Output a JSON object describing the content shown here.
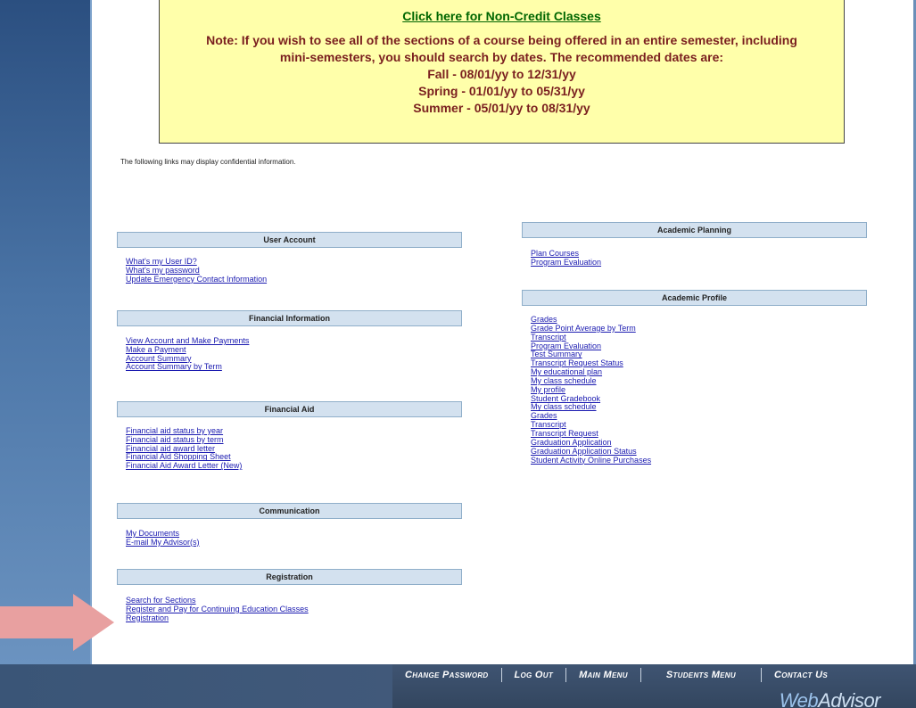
{
  "notice": {
    "link": "Click here for Non-Credit Classes",
    "lines": [
      "Note: If you wish to see all of the sections of a course being offered in an entire semester, including",
      "mini-semesters, you should search by dates. The recommended dates are:",
      "Fall - 08/01/yy to 12/31/yy",
      "Spring - 01/01/yy to 05/31/yy",
      "Summer - 05/01/yy to 08/31/yy"
    ]
  },
  "confidential_text": "The following links may display confidential information.",
  "sections": {
    "user_account": {
      "title": "User Account",
      "links": [
        "What's my User ID?",
        "What's my password",
        "Update Emergency Contact Information"
      ]
    },
    "financial_information": {
      "title": "Financial Information",
      "links": [
        "View Account and Make Payments",
        "Make a Payment",
        "Account Summary",
        "Account Summary by Term"
      ]
    },
    "financial_aid": {
      "title": "Financial Aid",
      "links": [
        "Financial aid status by year",
        "Financial aid status by term",
        "Financial aid award letter",
        "Financial Aid Shopping Sheet",
        "Financial Aid Award Letter (New)"
      ]
    },
    "communication": {
      "title": "Communication",
      "links": [
        "My Documents",
        "E-mail My Advisor(s)"
      ]
    },
    "registration": {
      "title": "Registration",
      "links": [
        "Search for Sections",
        "Register and Pay for Continuing Education Classes",
        "Registration"
      ]
    },
    "academic_planning": {
      "title": "Academic Planning",
      "links": [
        "Plan Courses",
        "Program Evaluation"
      ]
    },
    "academic_profile": {
      "title": "Academic Profile",
      "links": [
        "Grades",
        "Grade Point Average by Term",
        "Transcript",
        "Program Evaluation",
        "Test Summary",
        "Transcript Request Status",
        "My educational plan",
        "My class schedule",
        "My profile",
        "Student Gradebook",
        "My class schedule",
        "Grades",
        "Transcript",
        "Transcript Request",
        "Graduation Application",
        "Graduation Application Status",
        "Student Activity Online Purchases"
      ]
    }
  },
  "nav": [
    "Change Password",
    "Log Out",
    "Main Menu",
    "Students Menu",
    "Contact Us"
  ],
  "logo": {
    "part1": "Web",
    "part2": "Advisor"
  },
  "colors": {
    "notice_bg": "#ffffaa",
    "notice_link": "#006600",
    "notice_text": "#7a1f1f",
    "section_header": "#d3e1ef",
    "link": "#1a1ab0",
    "arrow": "#e8a0a0",
    "nav_bg": "#3f5472"
  }
}
